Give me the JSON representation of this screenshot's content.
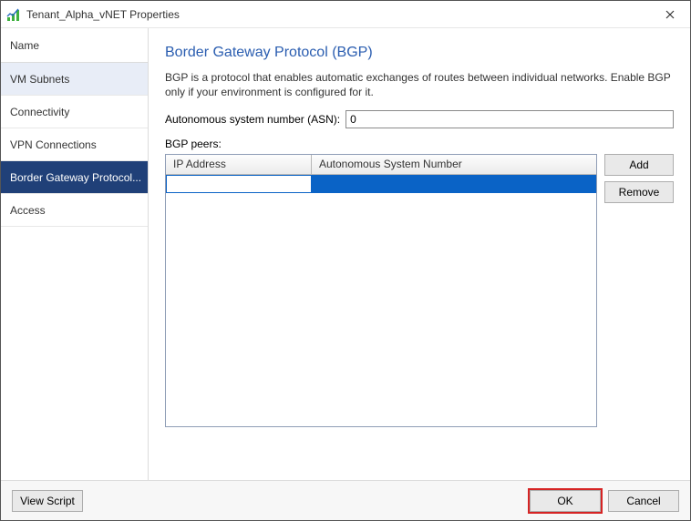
{
  "window": {
    "title": "Tenant_Alpha_vNET Properties"
  },
  "sidebar": {
    "header": "Name",
    "items": [
      {
        "label": "VM Subnets"
      },
      {
        "label": "Connectivity"
      },
      {
        "label": "VPN Connections"
      },
      {
        "label": "Border Gateway Protocol..."
      },
      {
        "label": "Access"
      }
    ]
  },
  "content": {
    "title": "Border Gateway Protocol (BGP)",
    "description": "BGP is a protocol that enables automatic exchanges of routes between individual networks. Enable BGP only if your environment is configured for it.",
    "asn_label": "Autonomous system number (ASN):",
    "asn_value": "0",
    "peers_label": "BGP peers:",
    "grid": {
      "columns": {
        "ip": "IP Address",
        "asn": "Autonomous System Number"
      },
      "rows": [
        {
          "ip": "",
          "asn": ""
        }
      ]
    },
    "buttons": {
      "add": "Add",
      "remove": "Remove"
    }
  },
  "footer": {
    "view_script": "View Script",
    "ok": "OK",
    "cancel": "Cancel"
  }
}
